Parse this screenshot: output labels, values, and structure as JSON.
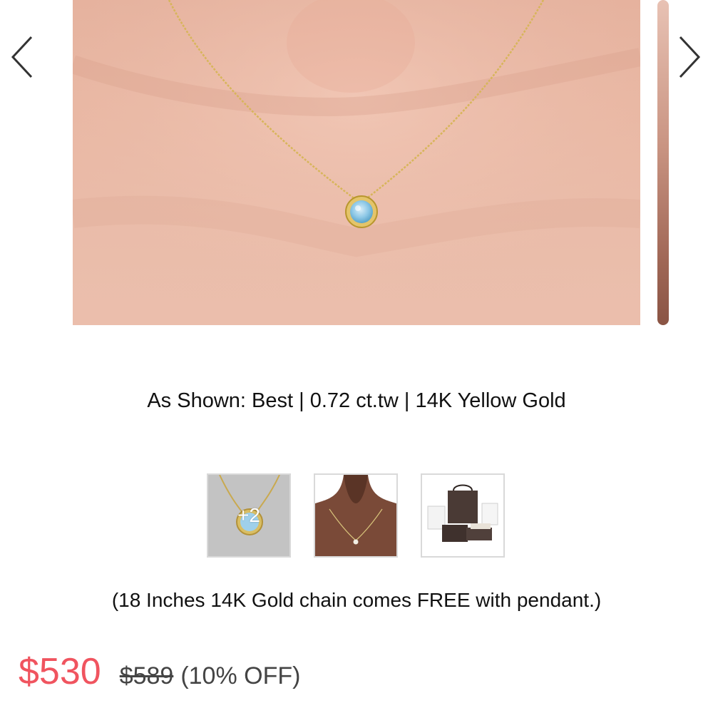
{
  "gallery": {
    "prev_icon": "chevron-left-icon",
    "next_icon": "chevron-right-icon",
    "variant_caption": "As Shown: Best | 0.72 ct.tw | 14K Yellow Gold"
  },
  "thumbnails": [
    {
      "kind": "pendant-closeup",
      "overlay_count": "+2"
    },
    {
      "kind": "model-wearing-necklace"
    },
    {
      "kind": "gift-packaging"
    }
  ],
  "chain_note": "(18 Inches 14K Gold chain comes FREE with pendant.)",
  "pricing": {
    "current_price": "$530",
    "original_price": "$589",
    "discount": "(10% OFF)",
    "current_color": "#f0545f"
  }
}
